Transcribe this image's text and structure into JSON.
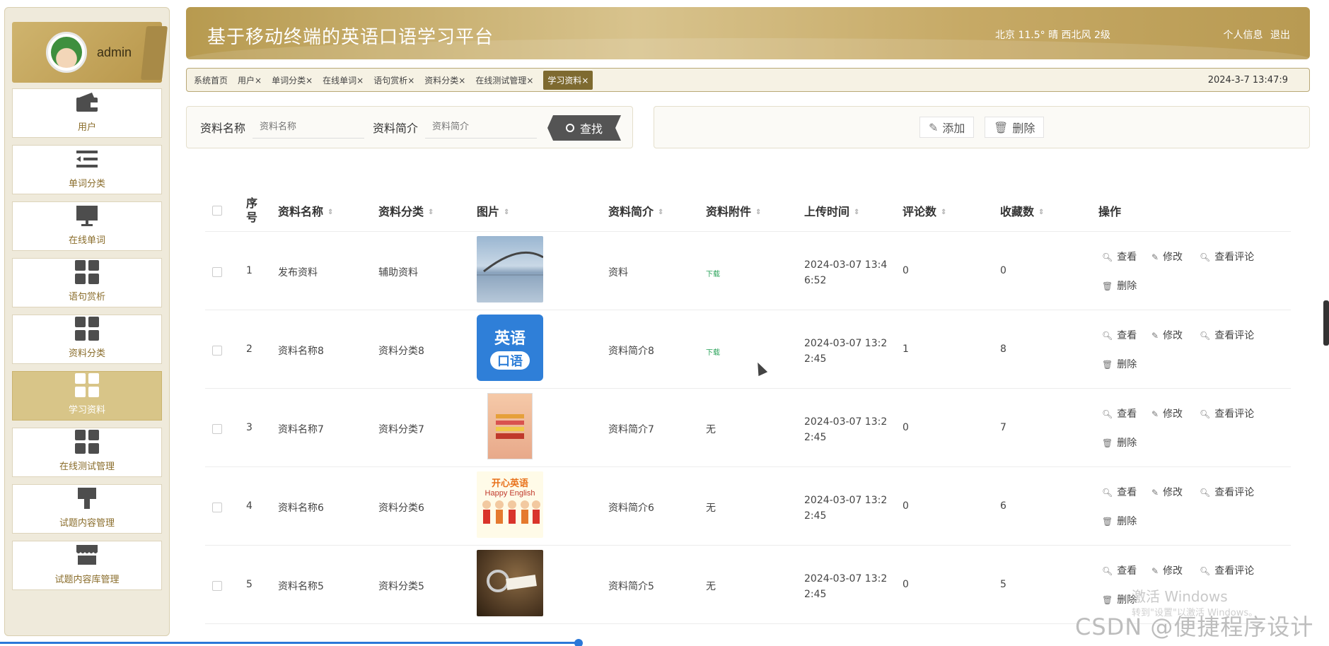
{
  "sidebar": {
    "username": "admin",
    "items": [
      {
        "label": "用户",
        "icon": "wallet-icon"
      },
      {
        "label": "单词分类",
        "icon": "list-indent-icon"
      },
      {
        "label": "在线单词",
        "icon": "monitor-icon"
      },
      {
        "label": "语句赏析",
        "icon": "grid-icon"
      },
      {
        "label": "资料分类",
        "icon": "grid-icon"
      },
      {
        "label": "学习资料",
        "icon": "grid-icon"
      },
      {
        "label": "在线测试管理",
        "icon": "grid-icon"
      },
      {
        "label": "试题内容管理",
        "icon": "brush-icon"
      },
      {
        "label": "试题内容库管理",
        "icon": "store-icon"
      }
    ],
    "active_index": 5
  },
  "header": {
    "title": "基于移动终端的英语口语学习平台",
    "weather": "北京  11.5°  晴  西北风  2级",
    "profile_link": "个人信息",
    "logout_link": "退出"
  },
  "tabs": {
    "items": [
      "系统首页",
      "用户×",
      "单词分类×",
      "在线单词×",
      "语句赏析×",
      "资料分类×",
      "在线测试管理×",
      "学习资料×"
    ],
    "active_index": 7,
    "clock": "2024-3-7 13:47:9"
  },
  "search": {
    "name_label": "资料名称",
    "name_placeholder": "资料名称",
    "intro_label": "资料简介",
    "intro_placeholder": "资料简介",
    "button_label": "查找"
  },
  "actions": {
    "add_label": "添加",
    "delete_label": "删除"
  },
  "table": {
    "headers": [
      "序号",
      "资料名称",
      "资料分类",
      "图片",
      "资料简介",
      "资料附件",
      "上传时间",
      "评论数",
      "收藏数",
      "操作"
    ],
    "rows": [
      {
        "no": "1",
        "name": "发布资料",
        "category": "辅助资料",
        "intro": "资料",
        "attachment": "下载",
        "time1": "2024-03-07 13:4",
        "time2": "6:52",
        "comments": "0",
        "favorites": "0"
      },
      {
        "no": "2",
        "name": "资料名称8",
        "category": "资料分类8",
        "intro": "资料简介8",
        "attachment": "下载",
        "time1": "2024-03-07 13:2",
        "time2": "2:45",
        "comments": "1",
        "favorites": "8"
      },
      {
        "no": "3",
        "name": "资料名称7",
        "category": "资料分类7",
        "intro": "资料简介7",
        "attachment": "无",
        "time1": "2024-03-07 13:2",
        "time2": "2:45",
        "comments": "0",
        "favorites": "7"
      },
      {
        "no": "4",
        "name": "资料名称6",
        "category": "资料分类6",
        "intro": "资料简介6",
        "attachment": "无",
        "time1": "2024-03-07 13:2",
        "time2": "2:45",
        "comments": "0",
        "favorites": "6"
      },
      {
        "no": "5",
        "name": "资料名称5",
        "category": "资料分类5",
        "intro": "资料简介5",
        "attachment": "无",
        "time1": "2024-03-07 13:2",
        "time2": "2:45",
        "comments": "0",
        "favorites": "5"
      }
    ],
    "ops": {
      "view": "查看",
      "edit": "修改",
      "view_comments": "查看评论",
      "delete": "删除"
    }
  },
  "thumb_texts": {
    "english_top": "英语",
    "english_bottom": "口语",
    "happy_cn": "开心英语",
    "happy_en": "Happy English"
  },
  "overlay": {
    "activate_title": "激活 Windows",
    "activate_sub": "转到\"设置\"以激活 Windows。",
    "csdn": "CSDN @便捷程序设计"
  }
}
